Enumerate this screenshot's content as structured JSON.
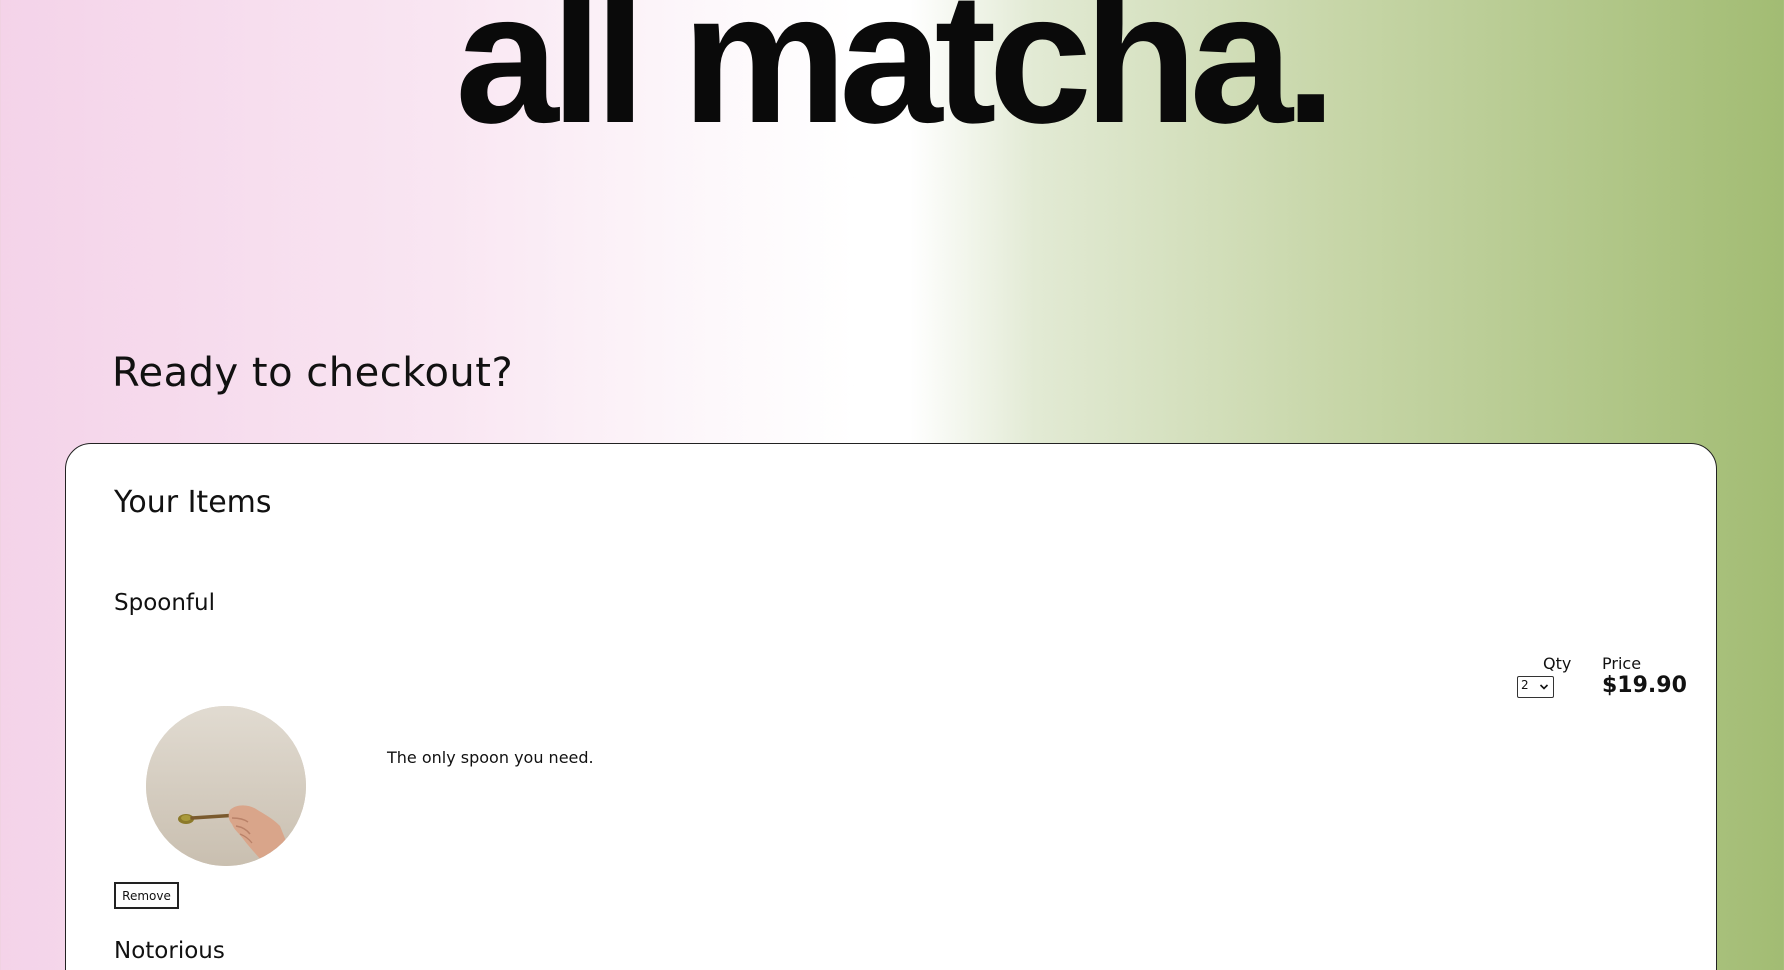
{
  "brand": {
    "name": "all matcha."
  },
  "page": {
    "heading": "Ready to checkout?"
  },
  "cart": {
    "title": "Your Items",
    "items": [
      {
        "name": "Spoonful",
        "description": "The only spoon you need.",
        "qty_label": "Qty",
        "qty_value": "2",
        "price_label": "Price",
        "price": "$19.90",
        "image": "hand-holding-spoon",
        "remove_label": "Remove"
      },
      {
        "name": "Notorious"
      }
    ]
  },
  "colors": {
    "gradient_left": "#f4d3e9",
    "gradient_right": "#a2bc73"
  }
}
